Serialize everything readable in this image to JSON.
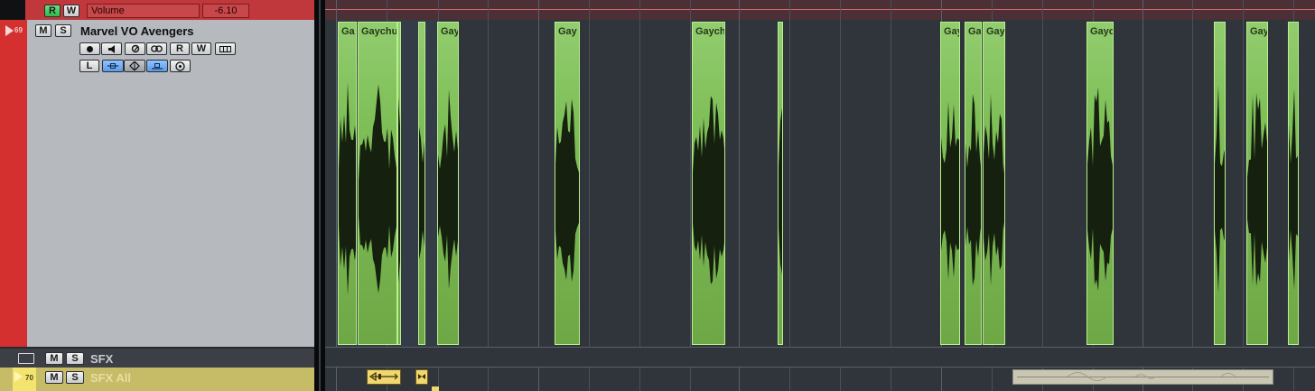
{
  "automation": {
    "read_label": "R",
    "write_label": "W",
    "param": "Volume",
    "value": "-6.10"
  },
  "tracks": [
    {
      "number": "69",
      "name": "Marvel VO Avengers",
      "mute": "M",
      "solo": "S",
      "read": "R",
      "write": "W",
      "lane_btn": "L"
    },
    {
      "name": "SFX",
      "mute": "M",
      "solo": "S"
    },
    {
      "number": "70",
      "name": "SFX All",
      "mute": "M",
      "solo": "S"
    }
  ],
  "events": [
    "Ga",
    "Gaychu",
    "",
    "",
    "Gay",
    "Gay",
    "Gaych",
    "",
    "Gay",
    "Ga",
    "Gay",
    "Gayc",
    "",
    "Gay",
    ""
  ],
  "colors": {
    "track_red": "#d4302f",
    "folder": "#3c4046",
    "sfx_yellow": "#c6bb67",
    "event_green": "#7fbf58"
  }
}
